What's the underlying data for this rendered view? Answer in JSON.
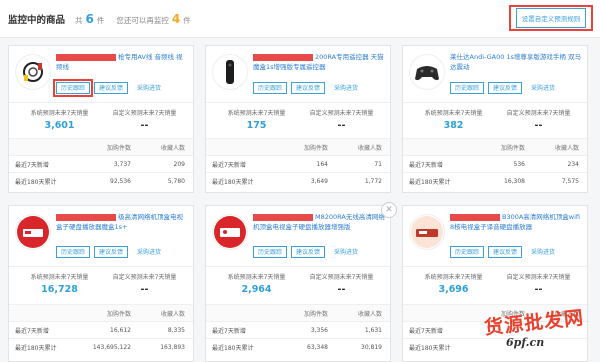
{
  "header": {
    "title": "监控中的商品",
    "count_prefix": "共",
    "count": "6",
    "count_unit": "件",
    "remaining_prefix": "您还可以再监控",
    "remaining": "4",
    "remaining_unit": "件",
    "settings_button": "设置自定义预测规则"
  },
  "labels": {
    "history": "历史跟踪",
    "feedback": "建议反馈",
    "source": "采购进货",
    "system_predict": "系统预测未来7天销量",
    "custom_predict": "自定义预测未来7天销量",
    "col_cart": "加购件数",
    "col_fav": "收藏人数",
    "row_7days": "最近7天新增",
    "row_180days": "最近180天累计"
  },
  "products": [
    {
      "title": "枪专用AV线 音频线 视频线",
      "thumb_icon": "cable-icon",
      "system_predict": "3,601",
      "custom_predict": "--",
      "cart_7": "3,737",
      "fav_7": "209",
      "cart_180": "92,536",
      "fav_180": "5,780"
    },
    {
      "title": "200RA专用遥控器 天猫魔盒1s增强版专属遥控器",
      "thumb_icon": "remote-icon",
      "system_predict": "175",
      "custom_predict": "--",
      "cart_7": "164",
      "fav_7": "71",
      "cart_180": "3,649",
      "fav_180": "1,772"
    },
    {
      "title": "莱仕达Andi-GA00 1s增尊享版游戏手柄 双马达震动",
      "thumb_icon": "gamepad-icon",
      "system_predict": "382",
      "custom_predict": "--",
      "cart_7": "536",
      "fav_7": "234",
      "cart_180": "16,308",
      "fav_180": "7,575"
    },
    {
      "title": "级高清网络机顶盒电视盒子硬盘播放器魔盒1s+",
      "thumb_icon": "tv-box-icon",
      "system_predict": "16,728",
      "custom_predict": "--",
      "cart_7": "16,612",
      "fav_7": "8,335",
      "cart_180": "143,695,122",
      "fav_180": "163,893"
    },
    {
      "title": "M8200RA无线高清网络机顶盒电视盒子硬盘播放器增强版",
      "thumb_icon": "tv-box-icon",
      "system_predict": "2,964",
      "custom_predict": "--",
      "cart_7": "3,356",
      "fav_7": "1,631",
      "cart_180": "63,348",
      "fav_180": "30,819"
    },
    {
      "title": "B300A高清网络机顶盒wifi 8核电视盒子译音硬盘播放器",
      "thumb_icon": "tv-box-icon",
      "system_predict": "3,696",
      "custom_predict": "--",
      "cart_7": "",
      "fav_7": "",
      "cart_180": "",
      "fav_180": ""
    }
  ],
  "watermark": {
    "line1": "货源批发网",
    "line2": "6pf.cn"
  },
  "colors": {
    "accent": "#2fa1d6",
    "highlight": "#e8423b",
    "warning": "#f5a623"
  }
}
